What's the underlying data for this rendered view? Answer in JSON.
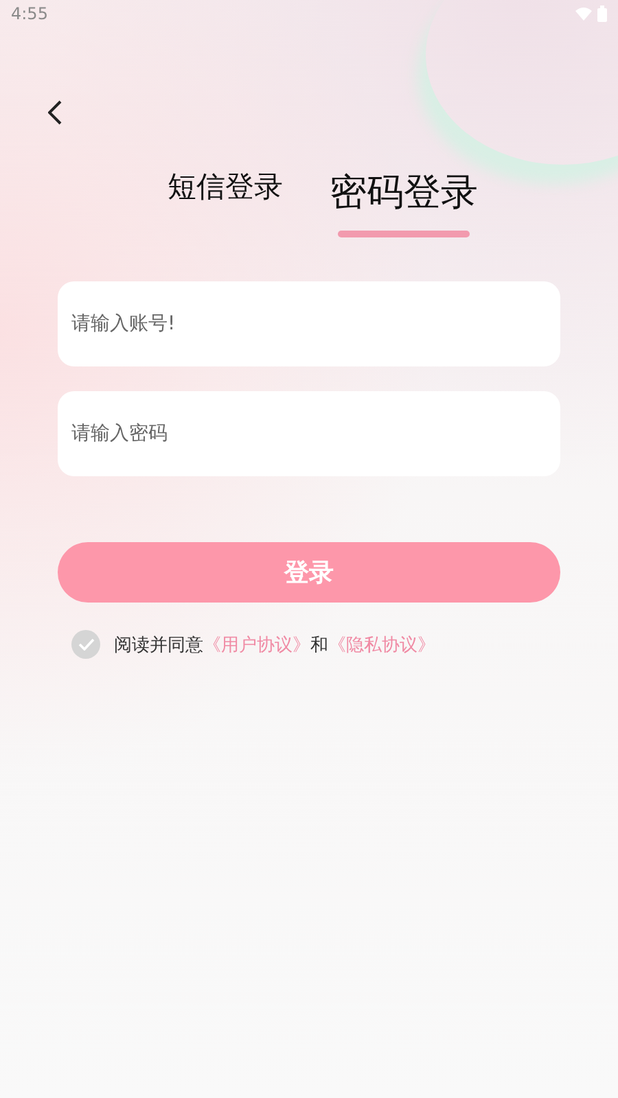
{
  "status_bar": {
    "time": "4:55"
  },
  "tabs": [
    {
      "label": "短信登录",
      "selected": false
    },
    {
      "label": "密码登录",
      "selected": true
    }
  ],
  "fields": [
    {
      "placeholder": "请输入账号!"
    },
    {
      "placeholder": "请输入密码"
    }
  ],
  "login_button": "登录",
  "agreement": {
    "checked": false,
    "prefix": "阅读并同意",
    "links": [
      "《用户协议》",
      "《隐私协议》"
    ],
    "joiner": "和"
  }
}
